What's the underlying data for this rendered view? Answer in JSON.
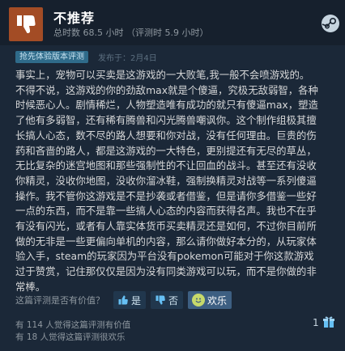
{
  "review": {
    "verdict": "不推荐",
    "hours": "总时数 68.5 小时 （评测时 5.9 小时）",
    "badge": "抢先体验版本评测",
    "posted": "发布于：2月4日",
    "body": "事实上，宠物可以买卖是这游戏的一大败笔,我一般不会喷游戏的。\n不得不说，这游戏的你的劲敌max就是个傻逼，究极无敌弱智，各种\n时候恶心人。剧情稀烂，人物塑造唯有成功的就只有傻逼max，塑造\n了他有多弱智，还有稀有腾兽和闪光腾兽嘲讽你。这个制作组极其擅\n长搞人心态，数不尽的路人想要和你对战，没有任何理由。巨贵的伤\n药和吝啬的路人，都是这游戏的一大特色，更别提还有无尽的草丛，\n无比复杂的迷宫地图和那些强制性的不让回血的战斗。甚至还有没收\n你精灵，没收你地图，没收你溜冰鞋，强制换精灵对战等一系列傻逼\n操作。我不管你这游戏是不是抄袭或者借鉴，但是请你多借鉴一些好\n一点的东西，而不是靠一些搞人心态的内容而获得名声。我也不在乎\n有没有闪光，或者有人靠实体货币买卖精灵还是如何，不过你目前所\n做的无非是一些更偏向单机的内容，那么请你做好本分的，从玩家体\n验入手，steam的玩家因为平台没有pokemon可能对于你这款游戏\n过于赞赏，记住那仅仅是因为没有同类游戏可以玩，而不是你做的非\n常棒。"
  },
  "helpful": {
    "question": "这篇评测是否有价值？",
    "yes_label": "是",
    "no_label": "否",
    "funny_label": "欢乐"
  },
  "stats": {
    "helpful_count": "有 114 人觉得这篇评测有价值",
    "funny_count": "有 18 人觉得这篇评测很欢乐"
  },
  "award": {
    "count": "1"
  },
  "icons": {
    "verdict": "thumbs-down-icon",
    "platform": "steam-icon",
    "yes": "thumbs-up-icon",
    "no": "thumbs-down-icon",
    "funny": "smiley-icon",
    "award": "award-icon"
  },
  "colors": {
    "background": "#1b2838",
    "header": "#16202d",
    "thumb_down": "#a34c25",
    "badge": "#2f6b8a",
    "link": "#66c0f4",
    "funny": "#c6d96b"
  }
}
